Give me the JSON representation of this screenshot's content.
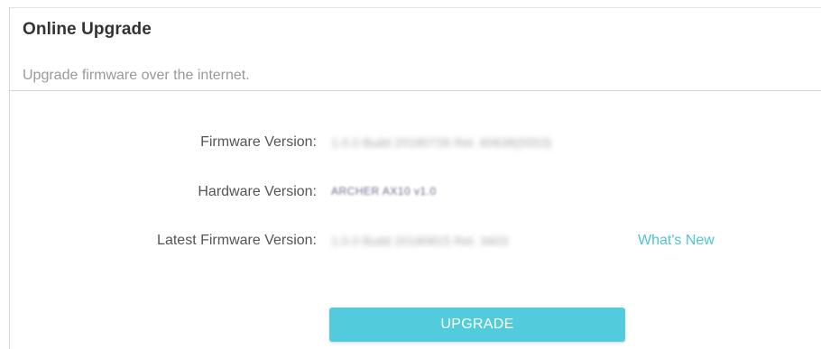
{
  "panel": {
    "title": "Online Upgrade",
    "description": "Upgrade firmware over the internet."
  },
  "fields": [
    {
      "label": "Firmware Version:",
      "value": "1.0.0 Build 20180726 Rel. 60638(5553)"
    },
    {
      "label": "Hardware Version:",
      "value": "ARCHER AX10 v1.0"
    },
    {
      "label": "Latest Firmware Version:",
      "value": "1.0.0 Build 20180815 Rel. 3403"
    }
  ],
  "whats_new_label": "What's New",
  "upgrade_button_label": "UPGRADE",
  "colors": {
    "accent": "#52ccdc",
    "link": "#4fc3d2",
    "title": "#333333",
    "label": "#555555",
    "muted": "#9a9a9a"
  }
}
